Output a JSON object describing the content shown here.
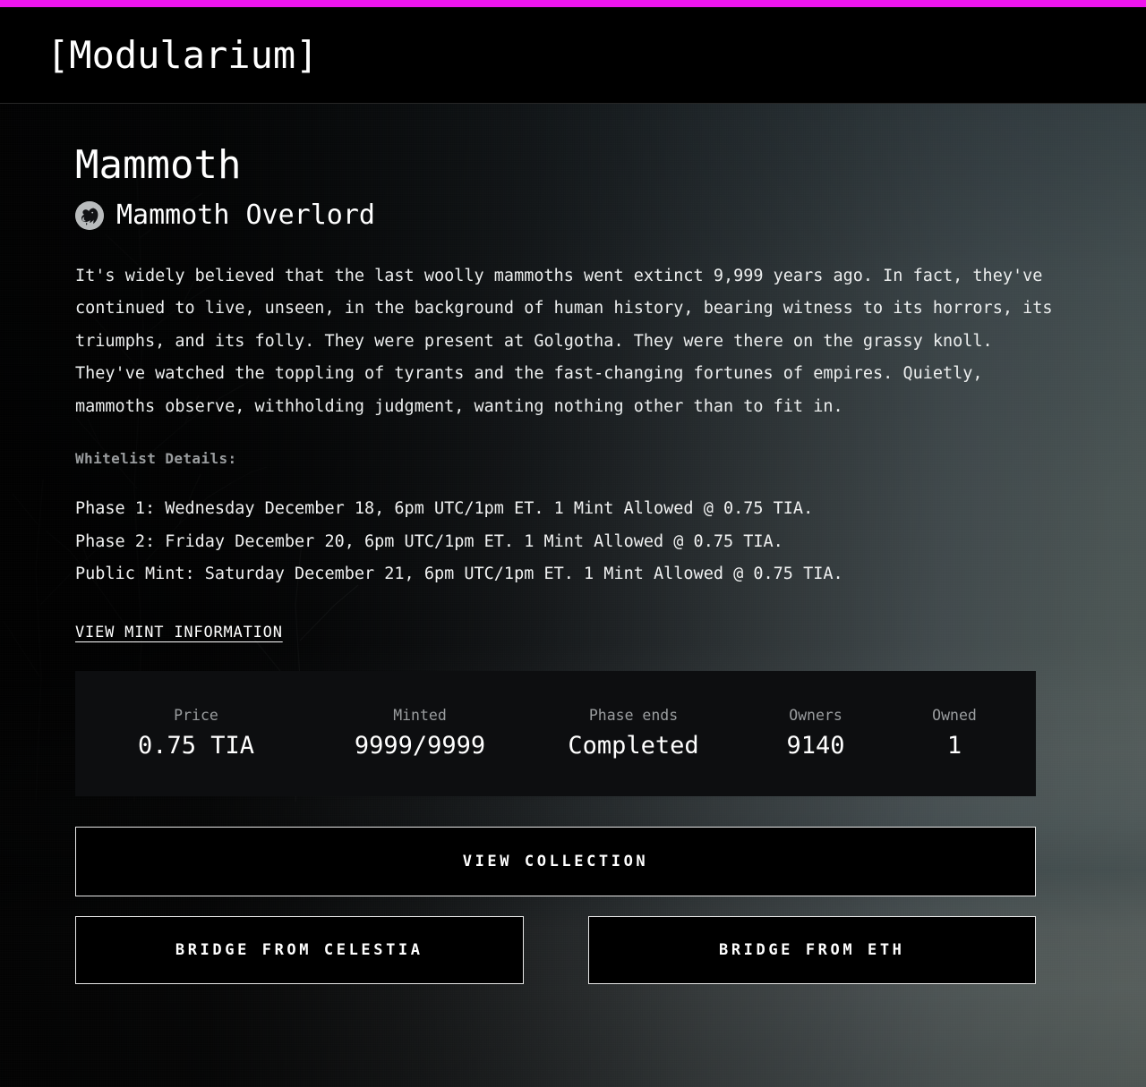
{
  "theme": {
    "accent": "#ee15ee",
    "header_bg": "#000000",
    "stats_bg": "#0d0e10",
    "text": "#ffffff",
    "muted": "#9a9d9f",
    "button_border": "#e8e8e8"
  },
  "header": {
    "brand": "[Modularium]"
  },
  "collection": {
    "title": "Mammoth",
    "creator": "Mammoth Overlord",
    "avatar_icon": "mammoth-avatar-icon",
    "description": "It's widely believed that the last woolly mammoths went extinct 9,999 years ago. In fact, they've continued to live, unseen, in the background of human history, bearing witness to its horrors, its triumphs, and its folly. They were present at Golgotha. They were there on the grassy knoll. They've watched the toppling of tyrants and the fast-changing fortunes of empires. Quietly, mammoths observe, withholding judgment, wanting nothing other than to fit in."
  },
  "whitelist": {
    "heading": "Whitelist Details:",
    "phases": [
      "Phase 1: Wednesday December 18, 6pm UTC/1pm ET. 1 Mint Allowed @ 0.75 TIA.",
      "Phase 2: Friday December 20, 6pm UTC/1pm ET. 1 Mint Allowed @ 0.75 TIA.",
      "Public Mint: Saturday December 21, 6pm UTC/1pm ET. 1 Mint Allowed @ 0.75 TIA."
    ],
    "mint_info_link": "VIEW MINT INFORMATION"
  },
  "stats": [
    {
      "label": "Price",
      "value": "0.75 TIA"
    },
    {
      "label": "Minted",
      "value": "9999/9999"
    },
    {
      "label": "Phase ends",
      "value": "Completed"
    },
    {
      "label": "Owners",
      "value": "9140"
    },
    {
      "label": "Owned",
      "value": "1"
    }
  ],
  "actions": {
    "view_collection": "VIEW COLLECTION",
    "bridge_celestia": "BRIDGE FROM CELESTIA",
    "bridge_eth": "BRIDGE FROM ETH"
  }
}
